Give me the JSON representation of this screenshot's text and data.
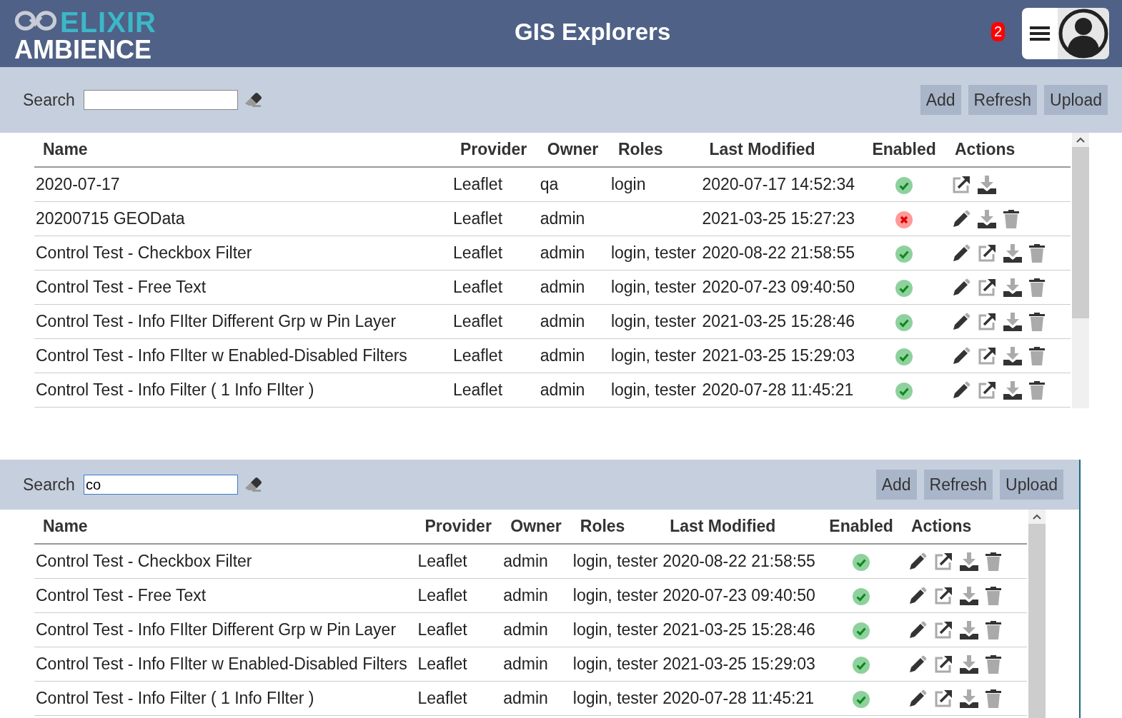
{
  "header": {
    "logo_top": "ELIXIR",
    "logo_bottom": "AMBIENCE",
    "title": "GIS Explorers",
    "notification_count": "2"
  },
  "panels": [
    {
      "search": {
        "label": "Search",
        "focused": false
      },
      "buttons": [
        "Add",
        "Refresh",
        "Upload"
      ],
      "columns": [
        "Name",
        "Provider",
        "Owner",
        "Roles",
        "Last Modified",
        "Enabled",
        "Actions"
      ],
      "rows": [
        {
          "name": "2020-07-17",
          "provider": "Leaflet",
          "owner": "qa",
          "roles": "login",
          "modified": "2020-07-17 14:52:34",
          "enabled": true,
          "actions": [
            {
              "kind": "open"
            },
            {
              "kind": "download"
            }
          ]
        },
        {
          "name": "20200715 GEOData",
          "provider": "Leaflet",
          "owner": "admin",
          "roles": "",
          "modified": "2021-03-25 15:27:23",
          "enabled": false,
          "actions": [
            {
              "kind": "edit"
            },
            {
              "kind": "download"
            },
            {
              "kind": "delete"
            }
          ]
        },
        {
          "name": "Control Test - Checkbox Filter",
          "provider": "Leaflet",
          "owner": "admin",
          "roles": "login, tester",
          "modified": "2020-08-22 21:58:55",
          "enabled": true,
          "actions": [
            {
              "kind": "edit"
            },
            {
              "kind": "open"
            },
            {
              "kind": "download"
            },
            {
              "kind": "delete"
            }
          ]
        },
        {
          "name": "Control Test - Free Text",
          "provider": "Leaflet",
          "owner": "admin",
          "roles": "login, tester",
          "modified": "2020-07-23 09:40:50",
          "enabled": true,
          "actions": [
            {
              "kind": "edit"
            },
            {
              "kind": "open"
            },
            {
              "kind": "download"
            },
            {
              "kind": "delete"
            }
          ]
        },
        {
          "name": "Control Test - Info FIlter Different Grp w Pin Layer",
          "provider": "Leaflet",
          "owner": "admin",
          "roles": "login, tester",
          "modified": "2021-03-25 15:28:46",
          "enabled": true,
          "actions": [
            {
              "kind": "edit"
            },
            {
              "kind": "open"
            },
            {
              "kind": "download"
            },
            {
              "kind": "delete"
            }
          ]
        },
        {
          "name": "Control Test - Info FIlter w Enabled-Disabled Filters",
          "provider": "Leaflet",
          "owner": "admin",
          "roles": "login, tester",
          "modified": "2021-03-25 15:29:03",
          "enabled": true,
          "actions": [
            {
              "kind": "edit"
            },
            {
              "kind": "open"
            },
            {
              "kind": "download"
            },
            {
              "kind": "delete"
            }
          ]
        },
        {
          "name": "Control Test - Info Filter ( 1 Info FIlter )",
          "provider": "Leaflet",
          "owner": "admin",
          "roles": "login, tester",
          "modified": "2020-07-28 11:45:21",
          "enabled": true,
          "actions": [
            {
              "kind": "edit"
            },
            {
              "kind": "open"
            },
            {
              "kind": "download"
            },
            {
              "kind": "delete"
            }
          ]
        }
      ]
    },
    {
      "search": {
        "label": "Search",
        "value": "co",
        "focused": true
      },
      "buttons": [
        "Add",
        "Refresh",
        "Upload"
      ],
      "columns": [
        "Name",
        "Provider",
        "Owner",
        "Roles",
        "Last Modified",
        "Enabled",
        "Actions"
      ],
      "rows": [
        {
          "name": "Control Test - Checkbox Filter",
          "provider": "Leaflet",
          "owner": "admin",
          "roles": "login, tester",
          "modified": "2020-08-22 21:58:55",
          "enabled": true,
          "actions": [
            {
              "kind": "edit"
            },
            {
              "kind": "open"
            },
            {
              "kind": "download"
            },
            {
              "kind": "delete"
            }
          ]
        },
        {
          "name": "Control Test - Free Text",
          "provider": "Leaflet",
          "owner": "admin",
          "roles": "login, tester",
          "modified": "2020-07-23 09:40:50",
          "enabled": true,
          "actions": [
            {
              "kind": "edit"
            },
            {
              "kind": "open"
            },
            {
              "kind": "download"
            },
            {
              "kind": "delete"
            }
          ]
        },
        {
          "name": "Control Test - Info FIlter Different Grp w Pin Layer",
          "provider": "Leaflet",
          "owner": "admin",
          "roles": "login, tester",
          "modified": "2021-03-25 15:28:46",
          "enabled": true,
          "actions": [
            {
              "kind": "edit"
            },
            {
              "kind": "open"
            },
            {
              "kind": "download"
            },
            {
              "kind": "delete"
            }
          ]
        },
        {
          "name": "Control Test - Info FIlter w Enabled-Disabled Filters",
          "provider": "Leaflet",
          "owner": "admin",
          "roles": "login, tester",
          "modified": "2021-03-25 15:29:03",
          "enabled": true,
          "actions": [
            {
              "kind": "edit"
            },
            {
              "kind": "open"
            },
            {
              "kind": "download"
            },
            {
              "kind": "delete"
            }
          ]
        },
        {
          "name": "Control Test - Info Filter ( 1 Info FIlter )",
          "provider": "Leaflet",
          "owner": "admin",
          "roles": "login, tester",
          "modified": "2020-07-28 11:45:21",
          "enabled": true,
          "actions": [
            {
              "kind": "edit"
            },
            {
              "kind": "open"
            },
            {
              "kind": "download"
            },
            {
              "kind": "delete"
            }
          ]
        }
      ]
    }
  ]
}
